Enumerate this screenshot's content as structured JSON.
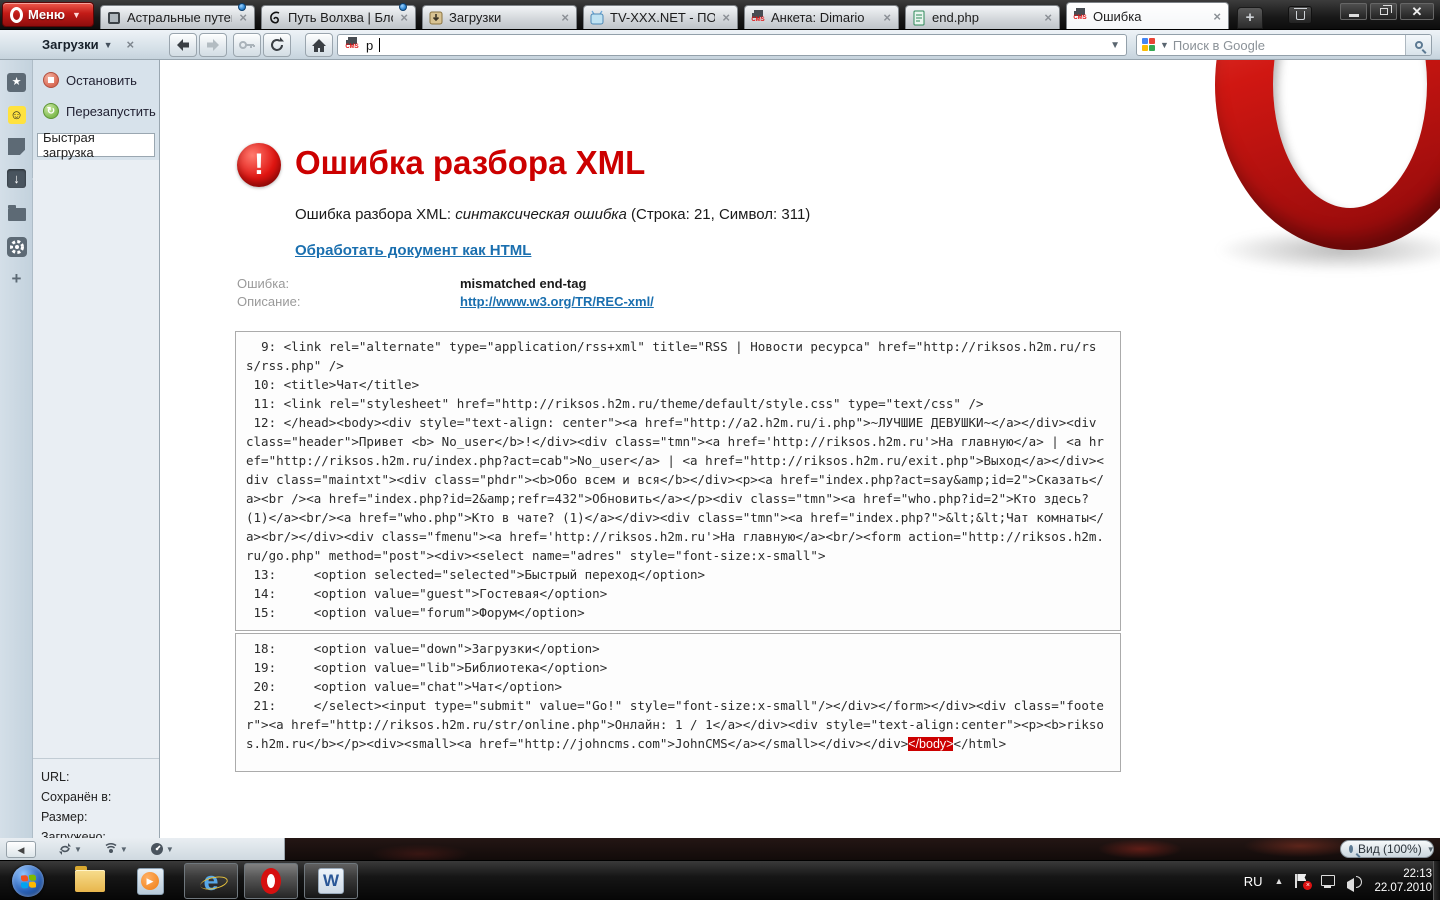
{
  "window": {
    "menu_label": "Меню"
  },
  "tabbar": {
    "tabs": [
      {
        "title": "Астральные путеш...",
        "unread": true
      },
      {
        "title": "Путь Волхва | Блог ...",
        "unread": true
      },
      {
        "title": "Загрузки",
        "unread": false
      },
      {
        "title": "TV-XXX.NET - ПОР...",
        "unread": false
      },
      {
        "title": "Анкета: Dimario",
        "unread": false
      },
      {
        "title": "end.php",
        "unread": false
      },
      {
        "title": "Ошибка",
        "unread": false
      }
    ],
    "new_tab_label": "+"
  },
  "toolbar": {
    "panel_title": "Загрузки",
    "address_value": "p",
    "search_placeholder": "Поиск в Google"
  },
  "sidebar": {
    "stop_label": "Остановить",
    "restart_label": "Перезапустить",
    "quick_download_placeholder": "Быстрая загрузка",
    "detail_labels": [
      "URL:",
      "Сохранён в:",
      "Размер:",
      "Загружено:"
    ]
  },
  "statusbar": {
    "zoom_label": "Вид (100%)"
  },
  "page": {
    "title": "Ошибка разбора XML",
    "subtitle_prefix": "Ошибка разбора XML: ",
    "subtitle_italic": "синтаксическая ошибка",
    "subtitle_suffix": " (Строка: 21, Символ: 311)",
    "action_link": "Обработать документ как HTML",
    "fields": [
      {
        "label": "Ошибка:",
        "value": "mismatched end-tag",
        "is_link": false
      },
      {
        "label": "Описание:",
        "value": "http://www.w3.org/TR/REC-xml/",
        "is_link": true
      }
    ],
    "code_blocks": [
      {
        "lines": [
          "  9: <link rel=\"alternate\" type=\"application/rss+xml\" title=\"RSS | Новости ресурса\" href=\"http://riksos.h2m.ru/rss/rss.php\" />",
          " 10: <title>Чат</title>",
          " 11: <link rel=\"stylesheet\" href=\"http://riksos.h2m.ru/theme/default/style.css\" type=\"text/css\" />",
          " 12: </head><body><div style=\"text-align: center\"><a href=\"http://a2.h2m.ru/i.php\">~ЛУЧШИЕ ДЕВУШКИ~</a></div><div class=\"header\">Привет <b> No_user</b>!</div><div class=\"tmn\"><a href='http://riksos.h2m.ru'>На главную</a> | <a href=\"http://riksos.h2m.ru/index.php?act=cab\">No_user</a> | <a href=\"http://riksos.h2m.ru/exit.php\">Выход</a></div><div class=\"maintxt\"><div class=\"phdr\"><b>Обо всем и вся</b></div><p><a href=\"index.php?act=say&amp;id=2\">Сказать</a><br /><a href=\"index.php?id=2&amp;refr=432\">Обновить</a></p><div class=\"tmn\"><a href=\"who.php?id=2\">Кто здесь?(1)</a><br/><a href=\"who.php\">Кто в чате? (1)</a></div><div class=\"tmn\"><a href=\"index.php?\">&lt;&lt;Чат комнаты</a><br/></div><div class=\"fmenu\"><a href='http://riksos.h2m.ru'>На главную</a><br/><form action=\"http://riksos.h2m.ru/go.php\" method=\"post\"><div><select name=\"adres\" style=\"font-size:x-small\">",
          " 13:     <option selected=\"selected\">Быстрый переход</option>",
          " 14:     <option value=\"guest\">Гостевая</option>",
          " 15:     <option value=\"forum\">Форум</option>"
        ],
        "highlight": ""
      },
      {
        "lines": [
          " 18:     <option value=\"down\">Загрузки</option>",
          " 19:     <option value=\"lib\">Библиотека</option>",
          " 20:     <option value=\"chat\">Чат</option>",
          " 21:     </select><input type=\"submit\" value=\"Go!\" style=\"font-size:x-small\"/></div></form></div><div class=\"footer\"><a href=\"http://riksos.h2m.ru/str/online.php\">Онлайн: 1 / 1</a></div><div style=\"text-align:center\"><p><b>riksos.h2m.ru</b></p><div><small><a href=\"http://johncms.com\">JohnCMS</a></small></div></div></body></html>"
        ],
        "highlight": "</body>"
      }
    ]
  },
  "tray": {
    "language": "RU",
    "time": "22:13",
    "date": "22.07.2010"
  }
}
